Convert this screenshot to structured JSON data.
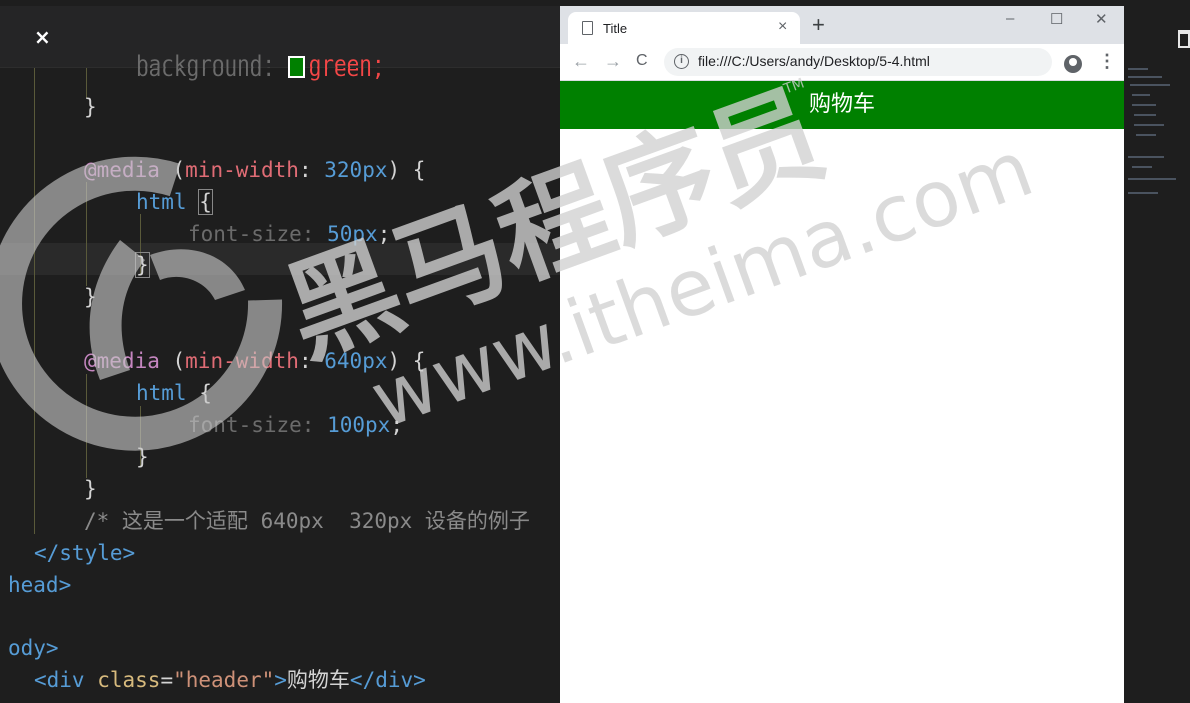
{
  "editor": {
    "close_glyph": "×",
    "lines": [
      {
        "prop": "background:",
        "value": "green;"
      },
      {
        "brace": "}"
      },
      {
        "at": "@media",
        "open": " (",
        "kw": "min-width",
        "colon": ": ",
        "num": "320",
        "unit": "px",
        "close": ") {"
      },
      {
        "sel": "html",
        "brace": "{"
      },
      {
        "prop": "font-size:",
        "num": "50",
        "unit": "px",
        "semi": ";"
      },
      {
        "brace": "}"
      },
      {
        "brace": "}"
      },
      {
        "at": "@media",
        "open": " (",
        "kw": "min-width",
        "colon": ": ",
        "num": "640",
        "unit": "px",
        "close": ") {"
      },
      {
        "sel": "html",
        "brace": "{"
      },
      {
        "prop": "font-size:",
        "num": "100",
        "unit": "px",
        "semi": ";"
      },
      {
        "brace": "}"
      },
      {
        "brace": "}"
      },
      {
        "comment": "/* 这是一个适配 640px  320px 设备的例子"
      },
      {
        "tag": "</style>"
      },
      {
        "tag": "head>"
      },
      {
        "tag": "ody>"
      },
      {
        "open_tag": "<div",
        "attr": "class",
        "eq": "=",
        "str": "\"header\"",
        "gt": ">",
        "text": "购物车",
        "close_tag": "</div>"
      }
    ]
  },
  "browser": {
    "tab_title": "Title",
    "tab_close": "×",
    "new_tab": "+",
    "window_controls": {
      "minimize": "–",
      "maximize": "☐",
      "close": "✕"
    },
    "nav": {
      "back": "←",
      "forward": "→",
      "reload": "C"
    },
    "url": "file:///C:/Users/andy/Desktop/5-4.html",
    "star": "☆",
    "menu": "⋮",
    "page_header_text": "购物车",
    "page_header_color": "#008000"
  },
  "watermark": {
    "brand": "黑马程序员",
    "url": "www.itheima.com",
    "tm": "TM"
  }
}
